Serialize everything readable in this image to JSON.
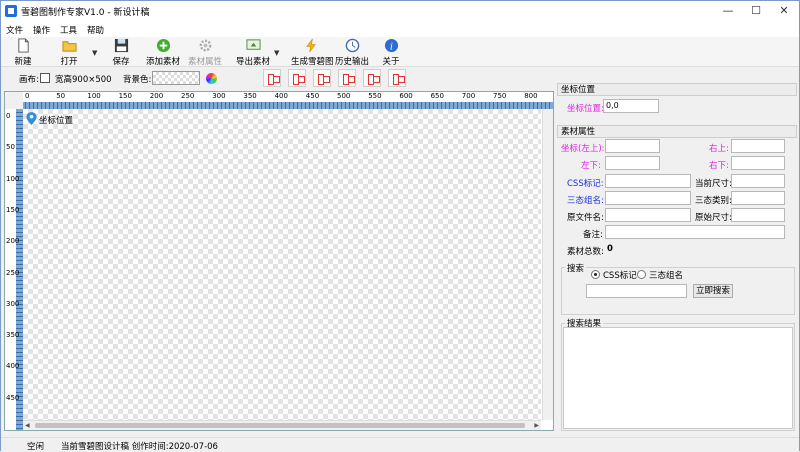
{
  "window": {
    "title": "雪碧图制作专家V1.0 - 新设计稿",
    "minimize": "—",
    "maximize": "☐",
    "close": "✕"
  },
  "menu": [
    "文件",
    "操作",
    "工具",
    "帮助"
  ],
  "toolbar": {
    "new": "新建",
    "open": "打开",
    "save": "保存",
    "add_material": "添加素材",
    "material_props": "素材属性",
    "export_material": "导出素材",
    "generate_sprite": "生成雪碧图",
    "history_export": "历史输出",
    "about": "关于"
  },
  "canvasbar": {
    "canvas_label": "画布:",
    "size_label": "宽高900×500",
    "bg_label": "背景色:"
  },
  "ruler": {
    "x_ticks": [
      "0",
      "50",
      "100",
      "150",
      "200",
      "250",
      "300",
      "350",
      "400",
      "450",
      "500",
      "550",
      "600",
      "650",
      "700",
      "750",
      "800"
    ],
    "y_ticks": [
      "0",
      "50",
      "100",
      "150",
      "200",
      "250",
      "300",
      "350",
      "400",
      "450"
    ]
  },
  "design": {
    "marker_label": "坐标位置"
  },
  "coord_panel": {
    "header": "坐标位置",
    "label": "坐标位置:",
    "value": "0,0"
  },
  "props_panel": {
    "header": "素材属性",
    "coord_topleft": "坐标(左上):",
    "top_right": "右上:",
    "bottom_left": "左下:",
    "bottom_right": "右下:",
    "css_mark": "CSS标记:",
    "current_size": "当前尺寸:",
    "tristate_name": "三态组名:",
    "tristate_type": "三态类别:",
    "orig_filename": "原文件名:",
    "orig_size": "原始尺寸:",
    "note": "备注:",
    "total_label": "素材总数:",
    "total_value": "0"
  },
  "search": {
    "title": "搜索",
    "opt_css": "CSS标记",
    "opt_tristate": "三态组名",
    "button": "立即搜索",
    "results_title": "搜索结果"
  },
  "status": {
    "state": "空闲",
    "doc": "当前雪碧图设计稿 创作时间:2020-07-06"
  }
}
